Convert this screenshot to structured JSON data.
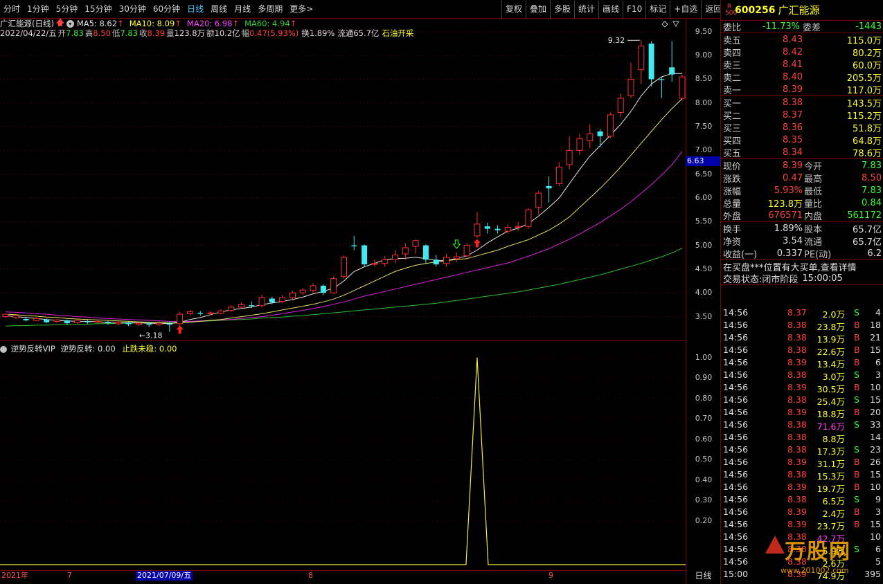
{
  "toolbar": {
    "left": [
      "分时",
      "1分钟",
      "5分钟",
      "15分钟",
      "30分钟",
      "60分钟",
      "日线",
      "周线",
      "月线",
      "多周期",
      "更多>"
    ],
    "active": "日线",
    "right": [
      "复权",
      "叠加",
      "多股",
      "统计",
      "画线",
      "F10",
      "标记",
      "+自选",
      "返回"
    ]
  },
  "chart_header": {
    "name": "广汇能源(日线)",
    "ma5": "MA5: 8.62",
    "ma10": "MA10: 8.09",
    "ma20": "MA20: 6.98",
    "ma60": "MA60: 4.94"
  },
  "info": {
    "date": "2022/04/22/五",
    "open_l": "开",
    "open": "7.83",
    "high_l": "高",
    "high": "8.50",
    "low_l": "低",
    "low": "7.83",
    "close_l": "收",
    "close": "8.39",
    "vol_l": "量",
    "vol": "123.8万",
    "amt_l": "额",
    "amt": "10.2亿",
    "amp_l": "幅",
    "amp": "0.47(5.93%)",
    "turn": "换1.89%",
    "float": "流通65.7亿",
    "concept": "石油开采"
  },
  "price_axis": [
    "9.50",
    "9.00",
    "8.50",
    "8.00",
    "7.50",
    "7.00",
    "6.50",
    "6.00",
    "5.50",
    "5.00",
    "4.50",
    "4.00",
    "3.50"
  ],
  "current_tag": "6.63",
  "markers": {
    "high": "9.32",
    "low": "3.18"
  },
  "indicator": {
    "name": "逆势反转VIP",
    "l1": "逆势反转: 0.00",
    "l2": "止跌未稳: 0.00"
  },
  "sub_axis": [
    "1.00",
    "0.90",
    "0.80",
    "0.70",
    "0.60",
    "0.50",
    "0.40",
    "0.30",
    "0.20"
  ],
  "date_axis": {
    "year": "2021年",
    "m7": "7",
    "hl": "2021/07/09/五",
    "m8": "8",
    "m9": "9"
  },
  "period_btn": "日线",
  "chart_data": {
    "type": "candlestick",
    "ylim": [
      3.1,
      9.6
    ],
    "candles": [
      [
        3.5,
        3.55,
        3.47,
        3.56
      ],
      [
        3.48,
        3.52,
        3.45,
        3.54
      ],
      [
        3.45,
        3.42,
        3.4,
        3.5
      ],
      [
        3.42,
        3.46,
        3.4,
        3.48
      ],
      [
        3.44,
        3.38,
        3.36,
        3.46
      ],
      [
        3.4,
        3.43,
        3.37,
        3.45
      ],
      [
        3.42,
        3.36,
        3.33,
        3.44
      ],
      [
        3.37,
        3.42,
        3.35,
        3.44
      ],
      [
        3.4,
        3.38,
        3.35,
        3.43
      ],
      [
        3.38,
        3.4,
        3.36,
        3.42
      ],
      [
        3.38,
        3.36,
        3.33,
        3.41
      ],
      [
        3.35,
        3.38,
        3.32,
        3.41
      ],
      [
        3.37,
        3.34,
        3.3,
        3.4
      ],
      [
        3.33,
        3.36,
        3.3,
        3.39
      ],
      [
        3.35,
        3.33,
        3.28,
        3.38
      ],
      [
        3.33,
        3.36,
        3.3,
        3.4
      ],
      [
        3.35,
        3.33,
        3.18,
        3.38
      ],
      [
        3.35,
        3.55,
        3.33,
        3.6
      ],
      [
        3.56,
        3.6,
        3.52,
        3.64
      ],
      [
        3.58,
        3.56,
        3.52,
        3.62
      ],
      [
        3.56,
        3.58,
        3.53,
        3.61
      ],
      [
        3.57,
        3.62,
        3.55,
        3.66
      ],
      [
        3.63,
        3.7,
        3.6,
        3.74
      ],
      [
        3.7,
        3.75,
        3.66,
        3.8
      ],
      [
        3.74,
        3.72,
        3.68,
        3.82
      ],
      [
        3.73,
        3.9,
        3.7,
        3.96
      ],
      [
        3.88,
        3.8,
        3.76,
        3.92
      ],
      [
        3.82,
        3.9,
        3.78,
        3.95
      ],
      [
        3.9,
        4.0,
        3.86,
        4.04
      ],
      [
        4.0,
        4.06,
        3.95,
        4.1
      ],
      [
        4.05,
        4.15,
        4.0,
        4.2
      ],
      [
        4.15,
        4.0,
        3.95,
        4.18
      ],
      [
        4.0,
        4.3,
        3.98,
        4.35
      ],
      [
        4.35,
        4.75,
        4.3,
        4.78
      ],
      [
        5.0,
        4.98,
        4.9,
        5.2
      ],
      [
        5.0,
        4.6,
        4.55,
        5.02
      ],
      [
        4.6,
        4.62,
        4.55,
        4.7
      ],
      [
        4.62,
        4.7,
        4.55,
        4.78
      ],
      [
        4.7,
        4.8,
        4.62,
        4.9
      ],
      [
        4.82,
        4.95,
        4.7,
        5.05
      ],
      [
        4.98,
        5.1,
        4.82,
        5.12
      ],
      [
        5.0,
        4.7,
        4.62,
        5.02
      ],
      [
        4.7,
        4.6,
        4.55,
        4.8
      ],
      [
        4.62,
        4.75,
        4.55,
        4.82
      ],
      [
        4.72,
        4.76,
        4.65,
        4.85
      ],
      [
        4.78,
        5.0,
        4.75,
        5.05
      ],
      [
        5.2,
        5.45,
        5.15,
        5.7
      ],
      [
        5.4,
        5.35,
        5.25,
        5.48
      ],
      [
        5.35,
        5.32,
        5.25,
        5.42
      ],
      [
        5.3,
        5.38,
        5.25,
        5.45
      ],
      [
        5.38,
        5.4,
        5.3,
        5.5
      ],
      [
        5.4,
        5.75,
        5.35,
        5.78
      ],
      [
        5.8,
        6.1,
        5.65,
        6.15
      ],
      [
        6.25,
        6.2,
        5.9,
        6.45
      ],
      [
        6.3,
        6.65,
        6.25,
        6.75
      ],
      [
        6.7,
        7.0,
        6.6,
        7.3
      ],
      [
        7.0,
        7.25,
        6.9,
        7.35
      ],
      [
        7.2,
        7.35,
        7.05,
        7.55
      ],
      [
        7.4,
        7.3,
        7.08,
        7.45
      ],
      [
        7.3,
        7.75,
        7.25,
        7.8
      ],
      [
        7.8,
        8.1,
        7.7,
        8.2
      ],
      [
        8.15,
        8.5,
        8.1,
        8.85
      ],
      [
        8.7,
        9.2,
        8.4,
        9.32
      ],
      [
        9.25,
        8.5,
        8.35,
        9.3
      ],
      [
        8.5,
        8.48,
        8.1,
        8.55
      ],
      [
        8.75,
        8.6,
        8.45,
        9.3
      ],
      [
        8.1,
        8.55,
        8.05,
        8.6
      ]
    ],
    "ma5": [
      3.52,
      3.5,
      3.48,
      3.46,
      3.44,
      3.42,
      3.41,
      3.4,
      3.4,
      3.39,
      3.38,
      3.38,
      3.37,
      3.37,
      3.36,
      3.36,
      3.35,
      3.38,
      3.44,
      3.48,
      3.54,
      3.6,
      3.64,
      3.67,
      3.7,
      3.75,
      3.79,
      3.82,
      3.86,
      3.91,
      3.98,
      4.03,
      4.1,
      4.25,
      4.45,
      4.55,
      4.62,
      4.7,
      4.72,
      4.73,
      4.75,
      4.72,
      4.68,
      4.68,
      4.72,
      4.78,
      4.9,
      5.05,
      5.18,
      5.3,
      5.36,
      5.46,
      5.62,
      5.8,
      6.0,
      6.3,
      6.6,
      6.88,
      7.1,
      7.32,
      7.55,
      7.82,
      8.15,
      8.4,
      8.55,
      8.62,
      8.62
    ],
    "ma10": [
      3.55,
      3.54,
      3.52,
      3.51,
      3.49,
      3.48,
      3.46,
      3.45,
      3.44,
      3.43,
      3.42,
      3.41,
      3.4,
      3.39,
      3.38,
      3.37,
      3.36,
      3.37,
      3.38,
      3.4,
      3.42,
      3.44,
      3.47,
      3.5,
      3.53,
      3.56,
      3.6,
      3.64,
      3.68,
      3.72,
      3.76,
      3.81,
      3.87,
      3.95,
      4.05,
      4.15,
      4.25,
      4.35,
      4.45,
      4.52,
      4.58,
      4.62,
      4.65,
      4.68,
      4.7,
      4.72,
      4.78,
      4.84,
      4.9,
      4.98,
      5.05,
      5.12,
      5.22,
      5.32,
      5.45,
      5.6,
      5.8,
      6.0,
      6.2,
      6.42,
      6.65,
      6.9,
      7.15,
      7.4,
      7.65,
      7.88,
      8.09
    ],
    "ma20": [
      3.6,
      3.59,
      3.58,
      3.56,
      3.55,
      3.53,
      3.52,
      3.5,
      3.49,
      3.47,
      3.46,
      3.45,
      3.44,
      3.43,
      3.42,
      3.41,
      3.4,
      3.4,
      3.4,
      3.41,
      3.42,
      3.43,
      3.44,
      3.46,
      3.48,
      3.5,
      3.53,
      3.56,
      3.6,
      3.63,
      3.67,
      3.71,
      3.76,
      3.81,
      3.87,
      3.93,
      3.98,
      4.03,
      4.08,
      4.13,
      4.18,
      4.23,
      4.28,
      4.33,
      4.38,
      4.43,
      4.48,
      4.53,
      4.58,
      4.63,
      4.7,
      4.77,
      4.85,
      4.93,
      5.03,
      5.13,
      5.24,
      5.36,
      5.48,
      5.62,
      5.76,
      5.92,
      6.1,
      6.28,
      6.48,
      6.7,
      6.98
    ],
    "ma60": [
      3.3,
      3.31,
      3.31,
      3.32,
      3.32,
      3.33,
      3.33,
      3.34,
      3.34,
      3.35,
      3.35,
      3.36,
      3.36,
      3.37,
      3.37,
      3.38,
      3.38,
      3.39,
      3.39,
      3.4,
      3.41,
      3.42,
      3.43,
      3.44,
      3.45,
      3.47,
      3.48,
      3.49,
      3.51,
      3.52,
      3.54,
      3.56,
      3.58,
      3.6,
      3.62,
      3.64,
      3.66,
      3.68,
      3.7,
      3.72,
      3.74,
      3.76,
      3.78,
      3.81,
      3.84,
      3.87,
      3.9,
      3.93,
      3.96,
      3.99,
      4.02,
      4.06,
      4.1,
      4.14,
      4.18,
      4.23,
      4.28,
      4.33,
      4.38,
      4.44,
      4.5,
      4.56,
      4.62,
      4.69,
      4.76,
      4.84,
      4.94
    ],
    "arrows": {
      "up_red": [
        17,
        46
      ],
      "down_green": [
        44
      ]
    },
    "indicator_values": {
      "peak_index": 46,
      "peak_value": 1.0,
      "ylim": [
        0,
        1.05
      ]
    }
  },
  "panel": {
    "code": "600256",
    "name": "广汇能源",
    "badge": "R\n500",
    "weibi_l": "委比",
    "weibi": "-11.73%",
    "weicha_l": "委差",
    "weicha": "-1443",
    "asks": [
      {
        "l": "卖五",
        "p": "8.43",
        "v": "115.0万"
      },
      {
        "l": "卖四",
        "p": "8.42",
        "v": "80.2万"
      },
      {
        "l": "卖三",
        "p": "8.41",
        "v": "60.0万"
      },
      {
        "l": "卖二",
        "p": "8.40",
        "v": "205.5万"
      },
      {
        "l": "卖一",
        "p": "8.39",
        "v": "117.0万"
      }
    ],
    "bids": [
      {
        "l": "买一",
        "p": "8.38",
        "v": "143.5万"
      },
      {
        "l": "买二",
        "p": "8.37",
        "v": "115.2万"
      },
      {
        "l": "买三",
        "p": "8.36",
        "v": "51.8万"
      },
      {
        "l": "买四",
        "p": "8.35",
        "v": "64.8万"
      },
      {
        "l": "买五",
        "p": "8.34",
        "v": "78.6万"
      }
    ],
    "stats": [
      {
        "l1": "现价",
        "v1": "8.39",
        "c1": "up",
        "l2": "今开",
        "v2": "7.83",
        "c2": "dn"
      },
      {
        "l1": "涨跌",
        "v1": "0.47",
        "c1": "up",
        "l2": "最高",
        "v2": "8.50",
        "c2": "up"
      },
      {
        "l1": "涨幅",
        "v1": "5.93%",
        "c1": "up",
        "l2": "最低",
        "v2": "7.83",
        "c2": "dn"
      },
      {
        "l1": "总量",
        "v1": "123.8万",
        "c1": "y",
        "l2": "量比",
        "v2": "0.84",
        "c2": "dn"
      },
      {
        "l1": "外盘",
        "v1": "676571",
        "c1": "up",
        "l2": "内盘",
        "v2": "561172",
        "c2": "dn"
      }
    ],
    "stats2": [
      {
        "l1": "换手",
        "v1": "1.89%",
        "l2": "股本",
        "v2": "65.7亿"
      },
      {
        "l1": "净资",
        "v1": "3.54",
        "l2": "流通",
        "v2": "65.7亿"
      },
      {
        "l1": "收益(一)",
        "v1": "0.337",
        "l2": "PE(动)",
        "v2": "6.2"
      }
    ],
    "notice": "在买盘***位置有大买单,查看详情",
    "status_l": "交易状态:",
    "status": "闭市阶段",
    "status_time": "15:00:05",
    "ticks": [
      [
        "14:56",
        "8.37",
        "2.0万",
        "S",
        "4",
        "dn"
      ],
      [
        "14:56",
        "8.38",
        "23.8万",
        "B",
        "18",
        "up"
      ],
      [
        "14:56",
        "8.38",
        "13.9万",
        "B",
        "21",
        "up"
      ],
      [
        "14:56",
        "8.38",
        "22.6万",
        "B",
        "15",
        "up"
      ],
      [
        "14:56",
        "8.39",
        "13.4万",
        "B",
        "6",
        "up"
      ],
      [
        "14:56",
        "8.38",
        "3.0万",
        "S",
        "3",
        "dn"
      ],
      [
        "14:56",
        "8.39",
        "30.5万",
        "B",
        "10",
        "up"
      ],
      [
        "14:56",
        "8.38",
        "25.4万",
        "S",
        "15",
        "dn"
      ],
      [
        "14:56",
        "8.39",
        "18.8万",
        "B",
        "20",
        "up"
      ],
      [
        "14:56",
        "8.38",
        "71.6万",
        "S",
        "33",
        "dn"
      ],
      [
        "14:56",
        "8.38",
        "8.8万",
        "",
        "14",
        ""
      ],
      [
        "14:56",
        "8.38",
        "17.3万",
        "S",
        "23",
        "dn"
      ],
      [
        "14:56",
        "8.39",
        "31.1万",
        "B",
        "26",
        "up"
      ],
      [
        "14:56",
        "8.38",
        "15.3万",
        "B",
        "15",
        "up"
      ],
      [
        "14:56",
        "8.39",
        "19.7万",
        "B",
        "10",
        "up"
      ],
      [
        "14:56",
        "8.38",
        "6.5万",
        "S",
        "9",
        "dn"
      ],
      [
        "14:56",
        "8.39",
        "2.4万",
        "B",
        "3",
        "up"
      ],
      [
        "14:56",
        "8.39",
        "23.7万",
        "B",
        "15",
        "up"
      ],
      [
        "14:56",
        "8.38",
        "42.7万",
        "",
        "10",
        ""
      ],
      [
        "14:56",
        "8.38",
        "5.9万",
        "S",
        "6",
        "dn"
      ],
      [
        "14:56",
        "8.38",
        "2.6万",
        "",
        "5",
        ""
      ],
      [
        "15:00",
        "8.39",
        "74.9万",
        "",
        "395",
        ""
      ]
    ],
    "watermark": "万股网",
    "watermark2": "www.201002.com"
  }
}
